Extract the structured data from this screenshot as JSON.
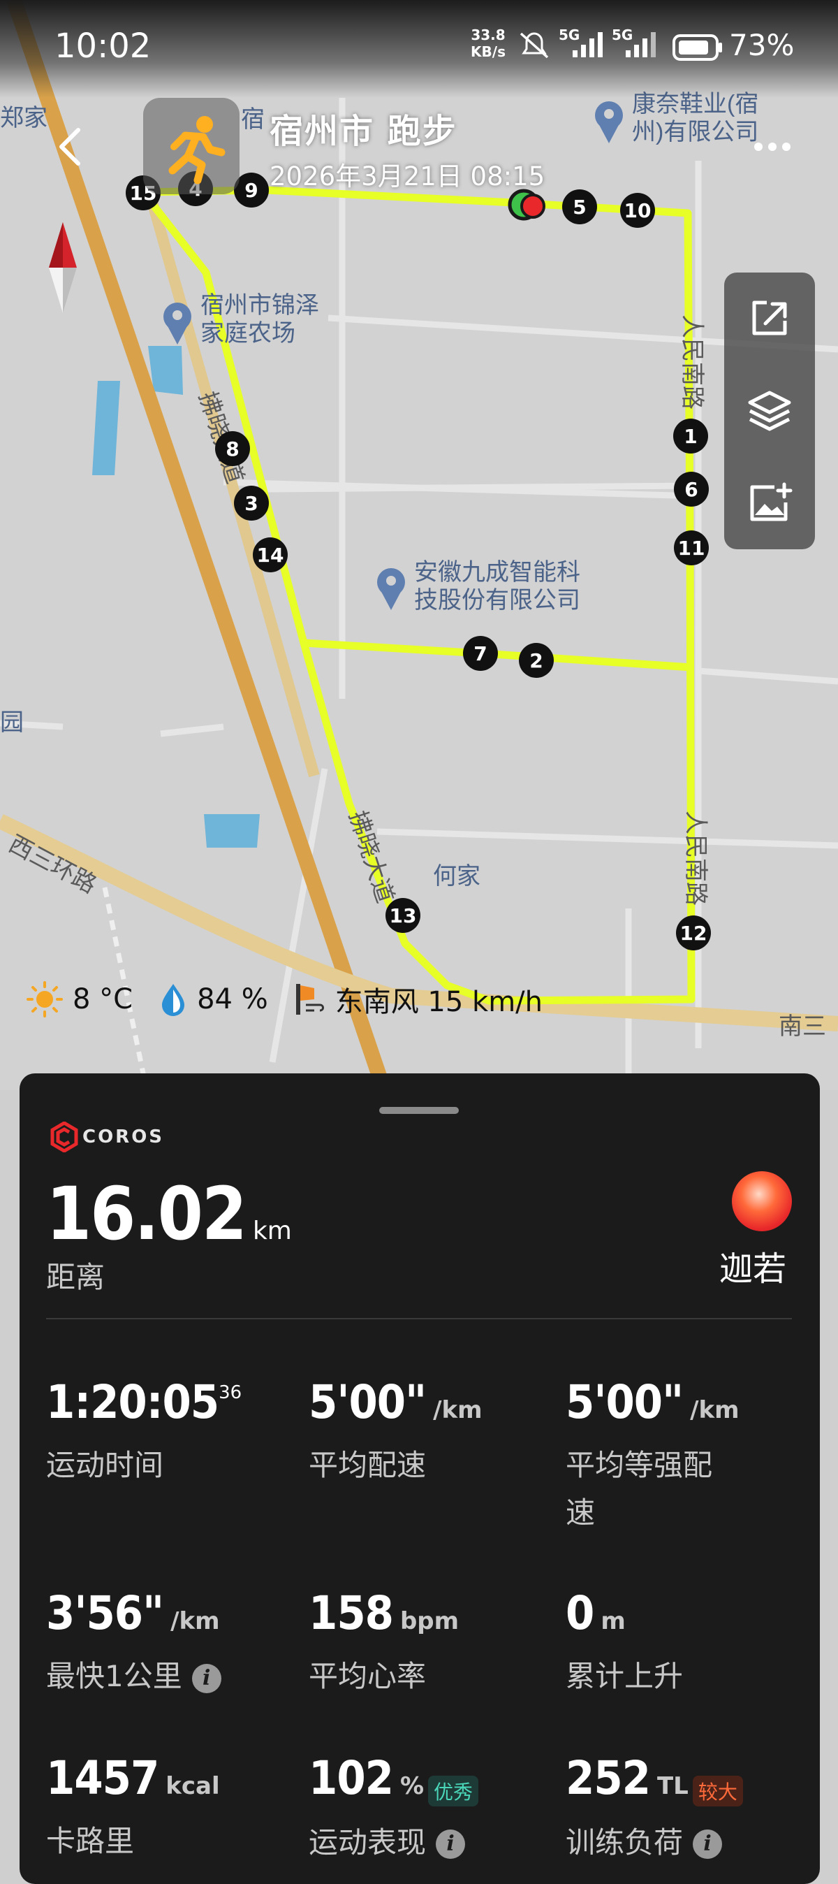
{
  "status_bar": {
    "time": "10:02",
    "net_speed_value": "33.8",
    "net_speed_unit": "KB/s",
    "signal_1": "5G",
    "signal_2": "5G",
    "battery": "73%"
  },
  "header": {
    "title": "宿州市 跑步",
    "datetime": "2026年3月21日 08:15"
  },
  "map": {
    "places": [
      "康奈鞋业(宿",
      "州)有限公司",
      "宿州市锦泽",
      "家庭农场",
      "安徽九成智能科",
      "技股份有限公司",
      "何家",
      "宿"
    ],
    "roads": [
      "西三环路",
      "南三",
      "人民南路",
      "人民南路",
      "拂晓大道",
      "拂晓大道"
    ],
    "edge_labels": [
      "郑家",
      "园",
      "家",
      "家"
    ],
    "markers": [
      "15",
      "4",
      "9",
      "5",
      "10",
      "8",
      "3",
      "14",
      "1",
      "6",
      "11",
      "7",
      "2",
      "13",
      "12"
    ],
    "route_color": "#e7ff26",
    "start_color": "#3ec24a",
    "end_color": "#e8282a"
  },
  "weather": {
    "temperature": "8 °C",
    "humidity": "84 %",
    "wind": "东南风 15 km/h"
  },
  "summary": {
    "brand": "COROS",
    "distance_value": "16.02",
    "distance_unit": "km",
    "distance_label": "距离",
    "user_name": "迦若"
  },
  "stats": [
    {
      "value": "1:20:05",
      "sup": "36",
      "unit": "",
      "label": "运动时间"
    },
    {
      "value": "5'00\"",
      "unit": "/km",
      "label": "平均配速"
    },
    {
      "value": "5'00\"",
      "unit": "/km",
      "label": "平均等强配速"
    },
    {
      "value": "3'56\"",
      "unit": "/km",
      "label": "最快1公里"
    },
    {
      "value": "158",
      "unit": "bpm",
      "label": "平均心率"
    },
    {
      "value": "0",
      "unit": "m",
      "label": "累计上升"
    },
    {
      "value": "1457",
      "unit": "kcal",
      "label": "卡路里"
    },
    {
      "value": "102",
      "unit": "%",
      "badge": "优秀",
      "label": "运动表现"
    },
    {
      "value": "252",
      "unit": "TL",
      "badge": "较大",
      "label": "训练负荷"
    }
  ],
  "accent": {
    "green_badge": "#4ad6b8",
    "orange_badge": "#ff6a3a",
    "brand_red": "#e8282a"
  }
}
